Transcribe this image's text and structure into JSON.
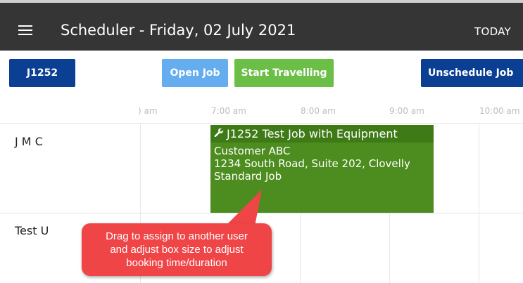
{
  "header": {
    "title": "Scheduler - Friday, 02 July 2021",
    "today_label": "TODAY",
    "menu_icon": "hamburger-menu-icon"
  },
  "toolbar": {
    "job_label": "J1252",
    "open_job_label": "Open Job",
    "start_travelling_label": "Start Travelling",
    "unschedule_label": "Unschedule Job"
  },
  "timeline": {
    "hours": [
      ") am",
      "7:00 am",
      "8:00 am",
      "9:00 am",
      "10:00 am"
    ]
  },
  "users": [
    "J M C",
    "Test U"
  ],
  "booking": {
    "icon": "wrench-icon",
    "title": "J1252 Test Job with Equipment",
    "customer": "Customer ABC",
    "address": "1234 South Road, Suite 202, Clovelly",
    "job_type": "Standard Job"
  },
  "callout": {
    "line1": "Drag to assign to another user",
    "line2": "and adjust box size to adjust",
    "line3": "booking time/duration"
  },
  "colors": {
    "header_bg": "#353535",
    "job_button": "#0b3f93",
    "open_job_button": "#64aef0",
    "start_travelling_button": "#6bbf46",
    "booking_bg": "#4d8d1f",
    "booking_header_bg": "#3e7a16",
    "callout_bg": "#ef4547"
  }
}
